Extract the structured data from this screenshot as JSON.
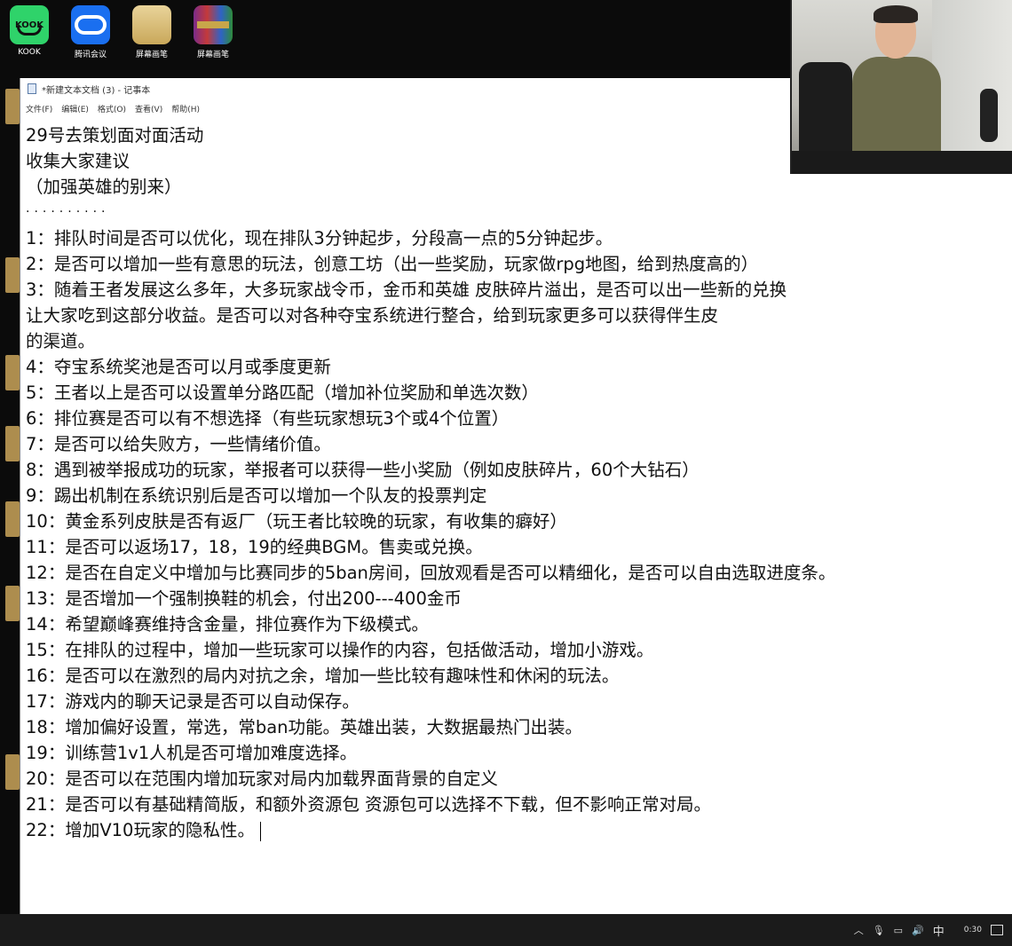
{
  "desktop": {
    "icons": [
      {
        "label": "KOOK",
        "icon": "kook-app-icon"
      },
      {
        "label": "腾讯会议",
        "icon": "tencent-meeting-icon"
      },
      {
        "label": "屏幕画笔",
        "icon": "folder-icon"
      },
      {
        "label": "屏幕画笔",
        "icon": "winrar-archive-icon"
      }
    ]
  },
  "notepad": {
    "title": "*新建文本文档 (3) - 记事本",
    "menu": [
      "文件(F)",
      "编辑(E)",
      "格式(O)",
      "查看(V)",
      "帮助(H)"
    ],
    "lines": [
      "29号去策划面对面活动",
      "收集大家建议",
      "（加强英雄的别来）",
      "··········",
      "1：排队时间是否可以优化，现在排队3分钟起步，分段高一点的5分钟起步。",
      "2：是否可以增加一些有意思的玩法，创意工坊（出一些奖励，玩家做rpg地图，给到热度高的）",
      "3：随着王者发展这么多年，大多玩家战令币，金币和英雄 皮肤碎片溢出，是否可以出一些新的兑换",
      "让大家吃到这部分收益。是否可以对各种夺宝系统进行整合，给到玩家更多可以获得伴生皮",
      "的渠道。",
      "4：夺宝系统奖池是否可以月或季度更新",
      "5：王者以上是否可以设置单分路匹配（增加补位奖励和单选次数）",
      "6：排位赛是否可以有不想选择（有些玩家想玩3个或4个位置）",
      "7：是否可以给失败方，一些情绪价值。",
      "8：遇到被举报成功的玩家，举报者可以获得一些小奖励（例如皮肤碎片，60个大钻石）",
      "9：踢出机制在系统识别后是否可以增加一个队友的投票判定",
      "10：黄金系列皮肤是否有返厂（玩王者比较晚的玩家，有收集的癖好）",
      "11：是否可以返场17，18，19的经典BGM。售卖或兑换。",
      "12：是否在自定义中增加与比赛同步的5ban房间，回放观看是否可以精细化，是否可以自由选取进度条。",
      "13：是否增加一个强制换鞋的机会，付出200---400金币",
      "14：希望巅峰赛维持含金量，排位赛作为下级模式。",
      "15：在排队的过程中，增加一些玩家可以操作的内容，包括做活动，增加小游戏。",
      "16：是否可以在激烈的局内对抗之余，增加一些比较有趣味性和休闲的玩法。",
      "17：游戏内的聊天记录是否可以自动保存。",
      "18：增加偏好设置，常选，常ban功能。英雄出装，大数据最热门出装。",
      "19：训练营1v1人机是否可增加难度选择。",
      "20：是否可以在范围内增加玩家对局内加载界面背景的自定义",
      "21：是否可以有基础精简版，和额外资源包  资源包可以选择不下载，但不影响正常对局。",
      "22：增加V10玩家的隐私性。"
    ]
  },
  "taskbar": {
    "tray_icons": [
      "chevron-up-icon",
      "microphone-icon",
      "network-icon",
      "volume-icon"
    ],
    "ime": "中",
    "time": "0:30",
    "notification_icon": "action-center-icon"
  }
}
